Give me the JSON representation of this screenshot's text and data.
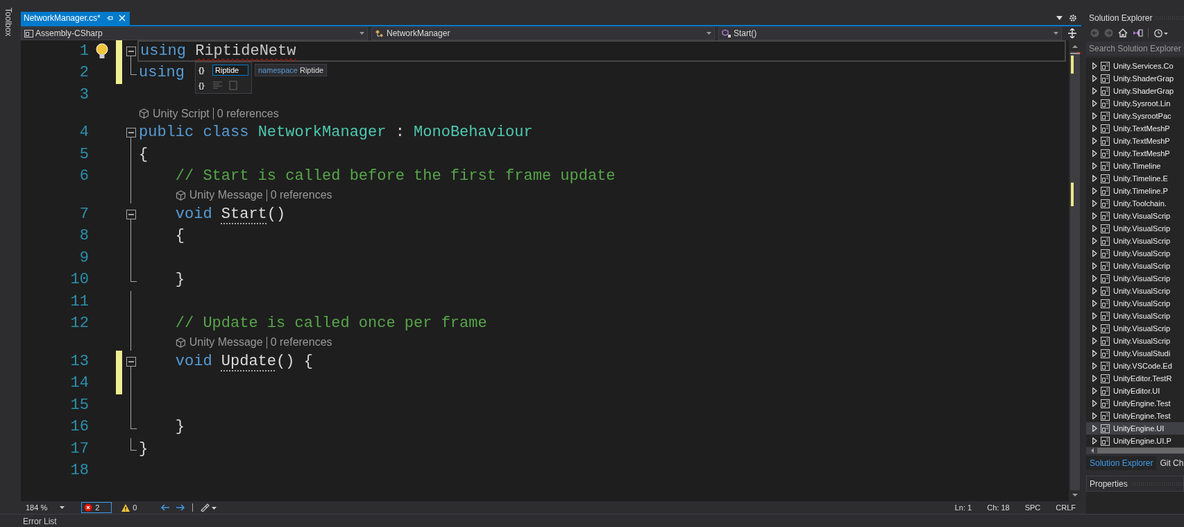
{
  "toolbox": {
    "label": "Toolbox"
  },
  "editor": {
    "tab": {
      "title": "NetworkManager.cs*",
      "selected": true
    },
    "nav": [
      {
        "kind": "project",
        "label": "Assembly-CSharp"
      },
      {
        "kind": "class",
        "label": "NetworkManager"
      },
      {
        "kind": "method",
        "label": "Start()"
      }
    ],
    "lines": [
      {
        "kind": "code",
        "number": "1",
        "changed": true,
        "lightbulb": true,
        "current": true,
        "indented": false,
        "collapsible": true,
        "in_block": false,
        "block_end": false,
        "tokens": [
          {
            "text": "using ",
            "kind": "keyword"
          },
          {
            "text": "RiptideNetw",
            "kind": "error"
          }
        ]
      },
      {
        "kind": "code",
        "number": "2",
        "changed": true,
        "lightbulb": false,
        "current": false,
        "indented": false,
        "collapsible": false,
        "in_block": false,
        "block_end": true,
        "tokens": [
          {
            "text": "using",
            "kind": "keyword"
          }
        ]
      },
      {
        "kind": "code",
        "number": "3",
        "changed": false,
        "lightbulb": false,
        "current": false,
        "collapsible": false,
        "in_block": false,
        "block_end": false
      },
      {
        "kind": "lens",
        "indented": false,
        "in_block": false,
        "label": "Unity Script",
        "refs": "0 references"
      },
      {
        "kind": "code",
        "number": "4",
        "changed": false,
        "lightbulb": false,
        "current": false,
        "indented": false,
        "collapsible": true,
        "in_block": false,
        "block_end": false,
        "tokens": [
          {
            "text": "public ",
            "kind": "keyword"
          },
          {
            "text": "class ",
            "kind": "keyword"
          },
          {
            "text": "NetworkManager ",
            "kind": "type"
          },
          {
            "text": ": ",
            "kind": "plain"
          },
          {
            "text": "MonoBehaviour",
            "kind": "type"
          }
        ]
      },
      {
        "kind": "code",
        "number": "5",
        "changed": false,
        "lightbulb": false,
        "current": false,
        "indented": false,
        "collapsible": false,
        "in_block": true,
        "block_end": false,
        "tokens": [
          {
            "text": "{",
            "kind": "plain"
          }
        ]
      },
      {
        "kind": "code",
        "number": "6",
        "changed": false,
        "lightbulb": false,
        "current": false,
        "indented": true,
        "collapsible": false,
        "in_block": true,
        "block_end": false,
        "tokens": [
          {
            "text": "// Start is called before the first frame update",
            "kind": "comment"
          }
        ]
      },
      {
        "kind": "lens",
        "indented": true,
        "in_block": true,
        "label": "Unity Message",
        "refs": "0 references"
      },
      {
        "kind": "code",
        "number": "7",
        "changed": false,
        "lightbulb": false,
        "current": false,
        "indented": true,
        "collapsible": true,
        "in_block": false,
        "block_end": false,
        "tokens": [
          {
            "text": "void ",
            "kind": "keyword"
          },
          {
            "text": "Start",
            "kind": "hinted"
          },
          {
            "text": "()",
            "kind": "plain"
          }
        ]
      },
      {
        "kind": "code",
        "number": "8",
        "changed": false,
        "lightbulb": false,
        "current": false,
        "indented": true,
        "collapsible": false,
        "in_block": true,
        "block_end": false,
        "tokens": [
          {
            "text": "{",
            "kind": "plain"
          }
        ]
      },
      {
        "kind": "code",
        "number": "9",
        "changed": false,
        "lightbulb": false,
        "current": false,
        "collapsible": false,
        "in_block": true,
        "block_end": false
      },
      {
        "kind": "code",
        "number": "10",
        "changed": false,
        "lightbulb": false,
        "current": false,
        "indented": true,
        "collapsible": false,
        "in_block": false,
        "block_end": true,
        "tokens": [
          {
            "text": "}",
            "kind": "plain"
          }
        ]
      },
      {
        "kind": "code",
        "number": "11",
        "changed": false,
        "lightbulb": false,
        "current": false,
        "collapsible": false,
        "in_block": true,
        "block_end": false
      },
      {
        "kind": "code",
        "number": "12",
        "changed": false,
        "lightbulb": false,
        "current": false,
        "indented": true,
        "collapsible": false,
        "in_block": true,
        "block_end": false,
        "tokens": [
          {
            "text": "// Update is called once per frame",
            "kind": "comment"
          }
        ]
      },
      {
        "kind": "lens",
        "indented": true,
        "in_block": true,
        "label": "Unity Message",
        "refs": "0 references"
      },
      {
        "kind": "code",
        "number": "13",
        "changed": true,
        "lightbulb": false,
        "current": false,
        "indented": true,
        "collapsible": true,
        "in_block": false,
        "block_end": false,
        "tokens": [
          {
            "text": "void ",
            "kind": "keyword"
          },
          {
            "text": "Update",
            "kind": "hinted"
          },
          {
            "text": "() {",
            "kind": "plain"
          }
        ]
      },
      {
        "kind": "code",
        "number": "14",
        "changed": true,
        "lightbulb": false,
        "current": false,
        "collapsible": false,
        "in_block": true,
        "block_end": false
      },
      {
        "kind": "code",
        "number": "15",
        "changed": false,
        "lightbulb": false,
        "current": false,
        "collapsible": false,
        "in_block": true,
        "block_end": false
      },
      {
        "kind": "code",
        "number": "16",
        "changed": false,
        "lightbulb": false,
        "current": false,
        "indented": true,
        "collapsible": false,
        "in_block": false,
        "block_end": true,
        "tokens": [
          {
            "text": "}",
            "kind": "plain"
          }
        ]
      },
      {
        "kind": "code",
        "number": "17",
        "changed": false,
        "lightbulb": false,
        "current": false,
        "indented": false,
        "collapsible": false,
        "in_block": false,
        "block_end": true,
        "tokens": [
          {
            "text": "}",
            "kind": "plain"
          }
        ]
      },
      {
        "kind": "code",
        "number": "18",
        "changed": false,
        "lightbulb": false,
        "current": false,
        "collapsible": false,
        "in_block": false,
        "block_end": false
      }
    ],
    "completion": {
      "glyph": "{}",
      "input": "Riptide",
      "detail_kind": "namespace",
      "detail_name": "Riptide",
      "filter_glyph": "{}"
    },
    "status": {
      "zoom": "184 %",
      "errors": "2",
      "warnings": "0",
      "line": "Ln: 1",
      "column": "Ch: 18",
      "whitespace": "SPC",
      "line_ending": "CRLF"
    }
  },
  "solution_explorer": {
    "title": "Solution Explorer",
    "search": {
      "placeholder": "Search Solution Explorer"
    },
    "items": [
      {
        "label": "Unity.Services.Co",
        "selected": false
      },
      {
        "label": "Unity.ShaderGrap",
        "selected": false
      },
      {
        "label": "Unity.ShaderGrap",
        "selected": false
      },
      {
        "label": "Unity.Sysroot.Lin",
        "selected": false
      },
      {
        "label": "Unity.SysrootPac",
        "selected": false
      },
      {
        "label": "Unity.TextMeshP",
        "selected": false
      },
      {
        "label": "Unity.TextMeshP",
        "selected": false
      },
      {
        "label": "Unity.TextMeshP",
        "selected": false
      },
      {
        "label": "Unity.Timeline",
        "selected": false
      },
      {
        "label": "Unity.Timeline.E",
        "selected": false
      },
      {
        "label": "Unity.Timeline.P",
        "selected": false
      },
      {
        "label": "Unity.Toolchain.",
        "selected": false
      },
      {
        "label": "Unity.VisualScrip",
        "selected": false
      },
      {
        "label": "Unity.VisualScrip",
        "selected": false
      },
      {
        "label": "Unity.VisualScrip",
        "selected": false
      },
      {
        "label": "Unity.VisualScrip",
        "selected": false
      },
      {
        "label": "Unity.VisualScrip",
        "selected": false
      },
      {
        "label": "Unity.VisualScrip",
        "selected": false
      },
      {
        "label": "Unity.VisualScrip",
        "selected": false
      },
      {
        "label": "Unity.VisualScrip",
        "selected": false
      },
      {
        "label": "Unity.VisualScrip",
        "selected": false
      },
      {
        "label": "Unity.VisualScrip",
        "selected": false
      },
      {
        "label": "Unity.VisualScrip",
        "selected": false
      },
      {
        "label": "Unity.VisualStudi",
        "selected": false
      },
      {
        "label": "Unity.VSCode.Ed",
        "selected": false
      },
      {
        "label": "UnityEditor.TestR",
        "selected": false
      },
      {
        "label": "UnityEditor.UI",
        "selected": false
      },
      {
        "label": "UnityEngine.Test",
        "selected": false
      },
      {
        "label": "UnityEngine.Test",
        "selected": false
      },
      {
        "label": "UnityEngine.UI",
        "selected": true
      },
      {
        "label": "UnityEngine.UI.P",
        "selected": false
      }
    ],
    "tabs": [
      {
        "label": "Solution Explorer",
        "selected": true
      },
      {
        "label": "Git Ch",
        "selected": false
      }
    ]
  },
  "properties": {
    "title": "Properties"
  },
  "bottom_panel": {
    "title": "Error List"
  }
}
